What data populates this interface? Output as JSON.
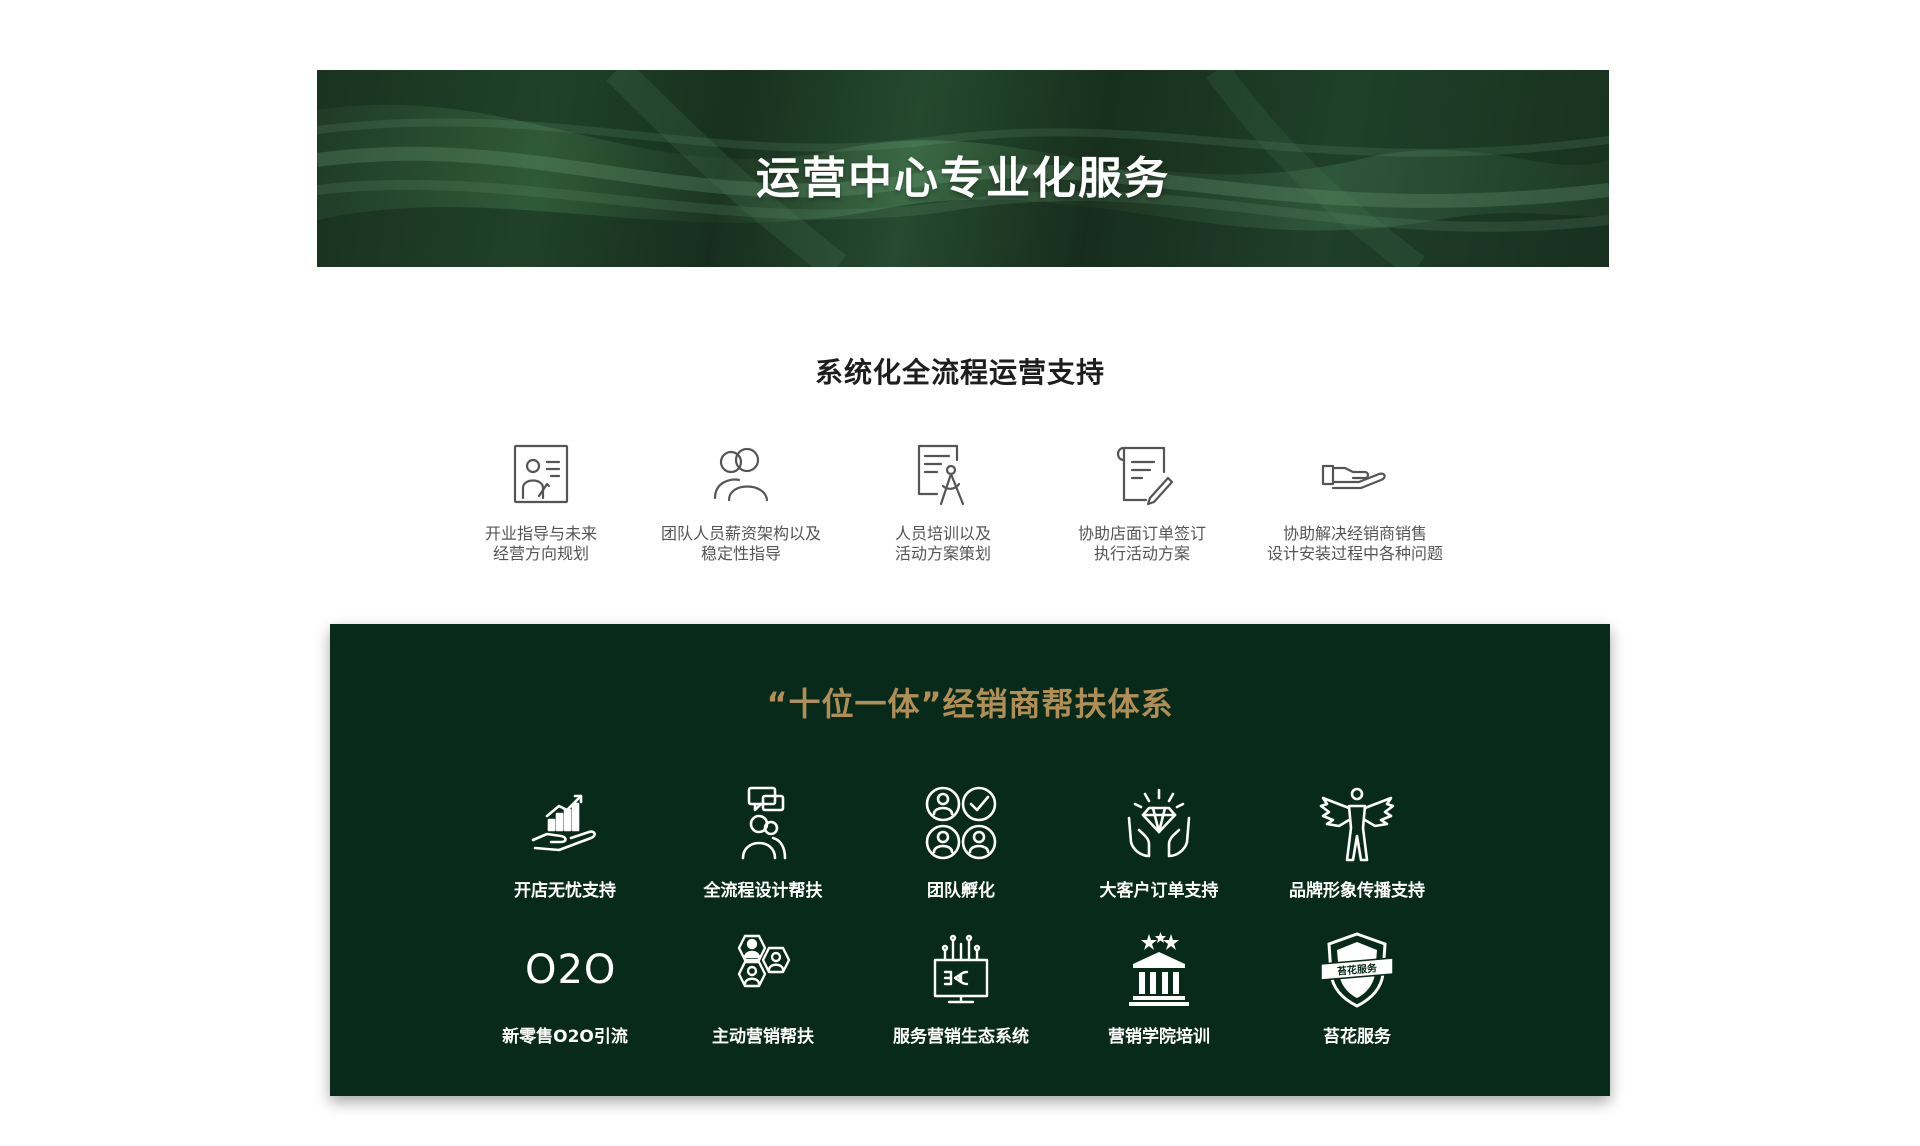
{
  "banner": {
    "title": "运营中心专业化服务"
  },
  "section1": {
    "title": "系统化全流程运营支持",
    "items": [
      {
        "icon": "consultation-board-icon",
        "line1": "开业指导与未来",
        "line2": "经营方向规划"
      },
      {
        "icon": "team-people-icon",
        "line1": "团队人员薪资架构以及",
        "line2": "稳定性指导"
      },
      {
        "icon": "training-document-icon",
        "line1": "人员培训以及",
        "line2": "活动方案策划"
      },
      {
        "icon": "order-sign-icon",
        "line1": "协助店面订单签订",
        "line2": "执行活动方案"
      },
      {
        "icon": "helping-hand-icon",
        "line1": "协助解决经销商销售",
        "line2": "设计安装过程中各种问题"
      }
    ]
  },
  "section2": {
    "title": "“十位一体”经销商帮扶体系",
    "title_color": "#b08e55",
    "background_color": "#082a1a",
    "items": [
      {
        "icon": "growth-hand-icon",
        "label": "开店无忧支持"
      },
      {
        "icon": "designer-chat-icon",
        "label": "全流程设计帮扶"
      },
      {
        "icon": "team-grid-icon",
        "label": "团队孵化"
      },
      {
        "icon": "diamond-hands-icon",
        "label": "大客户订单支持"
      },
      {
        "icon": "winged-brand-icon",
        "label": "品牌形象传播支持"
      },
      {
        "icon": "o2o-text-icon",
        "label": "新零售O2O引流",
        "icon_text": "O2O"
      },
      {
        "icon": "hexagon-people-icon",
        "label": "主动营销帮扶"
      },
      {
        "icon": "ecosystem-monitor-icon",
        "label": "服务营销生态系统"
      },
      {
        "icon": "academy-building-icon",
        "label": "营销学院培训"
      },
      {
        "icon": "shield-badge-icon",
        "label": "苔花服务",
        "icon_text": "苔花服务"
      }
    ]
  }
}
